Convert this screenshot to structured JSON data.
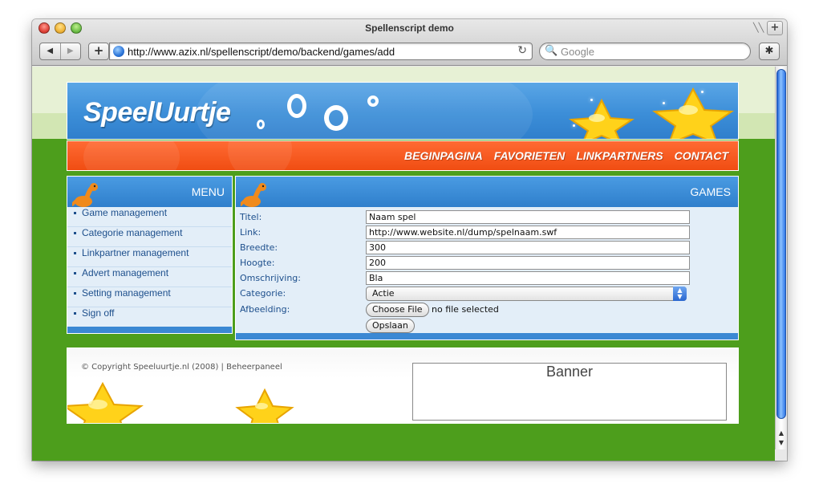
{
  "window": {
    "title": "Spellenscript demo",
    "url": "http://www.azix.nl/spellenscript/demo/backend/games/add",
    "search_placeholder": "Google",
    "back_label": "◀",
    "forward_label": "▶",
    "add_label": "+",
    "reload_label": "↻",
    "tab_plus_label": "+"
  },
  "site": {
    "logo": "SpeelUurtje",
    "nav": [
      "BEGINPAGINA",
      "FAVORIETEN",
      "LINKPARTNERS",
      "CONTACT"
    ]
  },
  "menu": {
    "title": "MENU",
    "items": [
      "Game management",
      "Categorie management",
      "Linkpartner management",
      "Advert management",
      "Setting management",
      "Sign off"
    ]
  },
  "games": {
    "title": "GAMES",
    "fields": {
      "titel_label": "Titel:",
      "titel_value": "Naam spel",
      "link_label": "Link:",
      "link_value": "http://www.website.nl/dump/spelnaam.swf",
      "breedte_label": "Breedte:",
      "breedte_value": "300",
      "hoogte_label": "Hoogte:",
      "hoogte_value": "200",
      "omschrijving_label": "Omschrijving:",
      "omschrijving_value": "Bla",
      "categorie_label": "Categorie:",
      "categorie_value": "Actie",
      "afbeelding_label": "Afbeelding:",
      "choose_file_label": "Choose File",
      "no_file_text": "no file selected",
      "submit_label": "Opslaan"
    }
  },
  "footer": {
    "copyright": "© Copyright Speeluurtje.nl (2008) | Beheerpaneel",
    "banner": "Banner"
  },
  "colors": {
    "header_blue": "#3c8ed8",
    "nav_orange": "#f04d12",
    "page_green": "#4d9e1c",
    "panel_bg": "#e3eef8",
    "link_text": "#1d4f8c"
  }
}
